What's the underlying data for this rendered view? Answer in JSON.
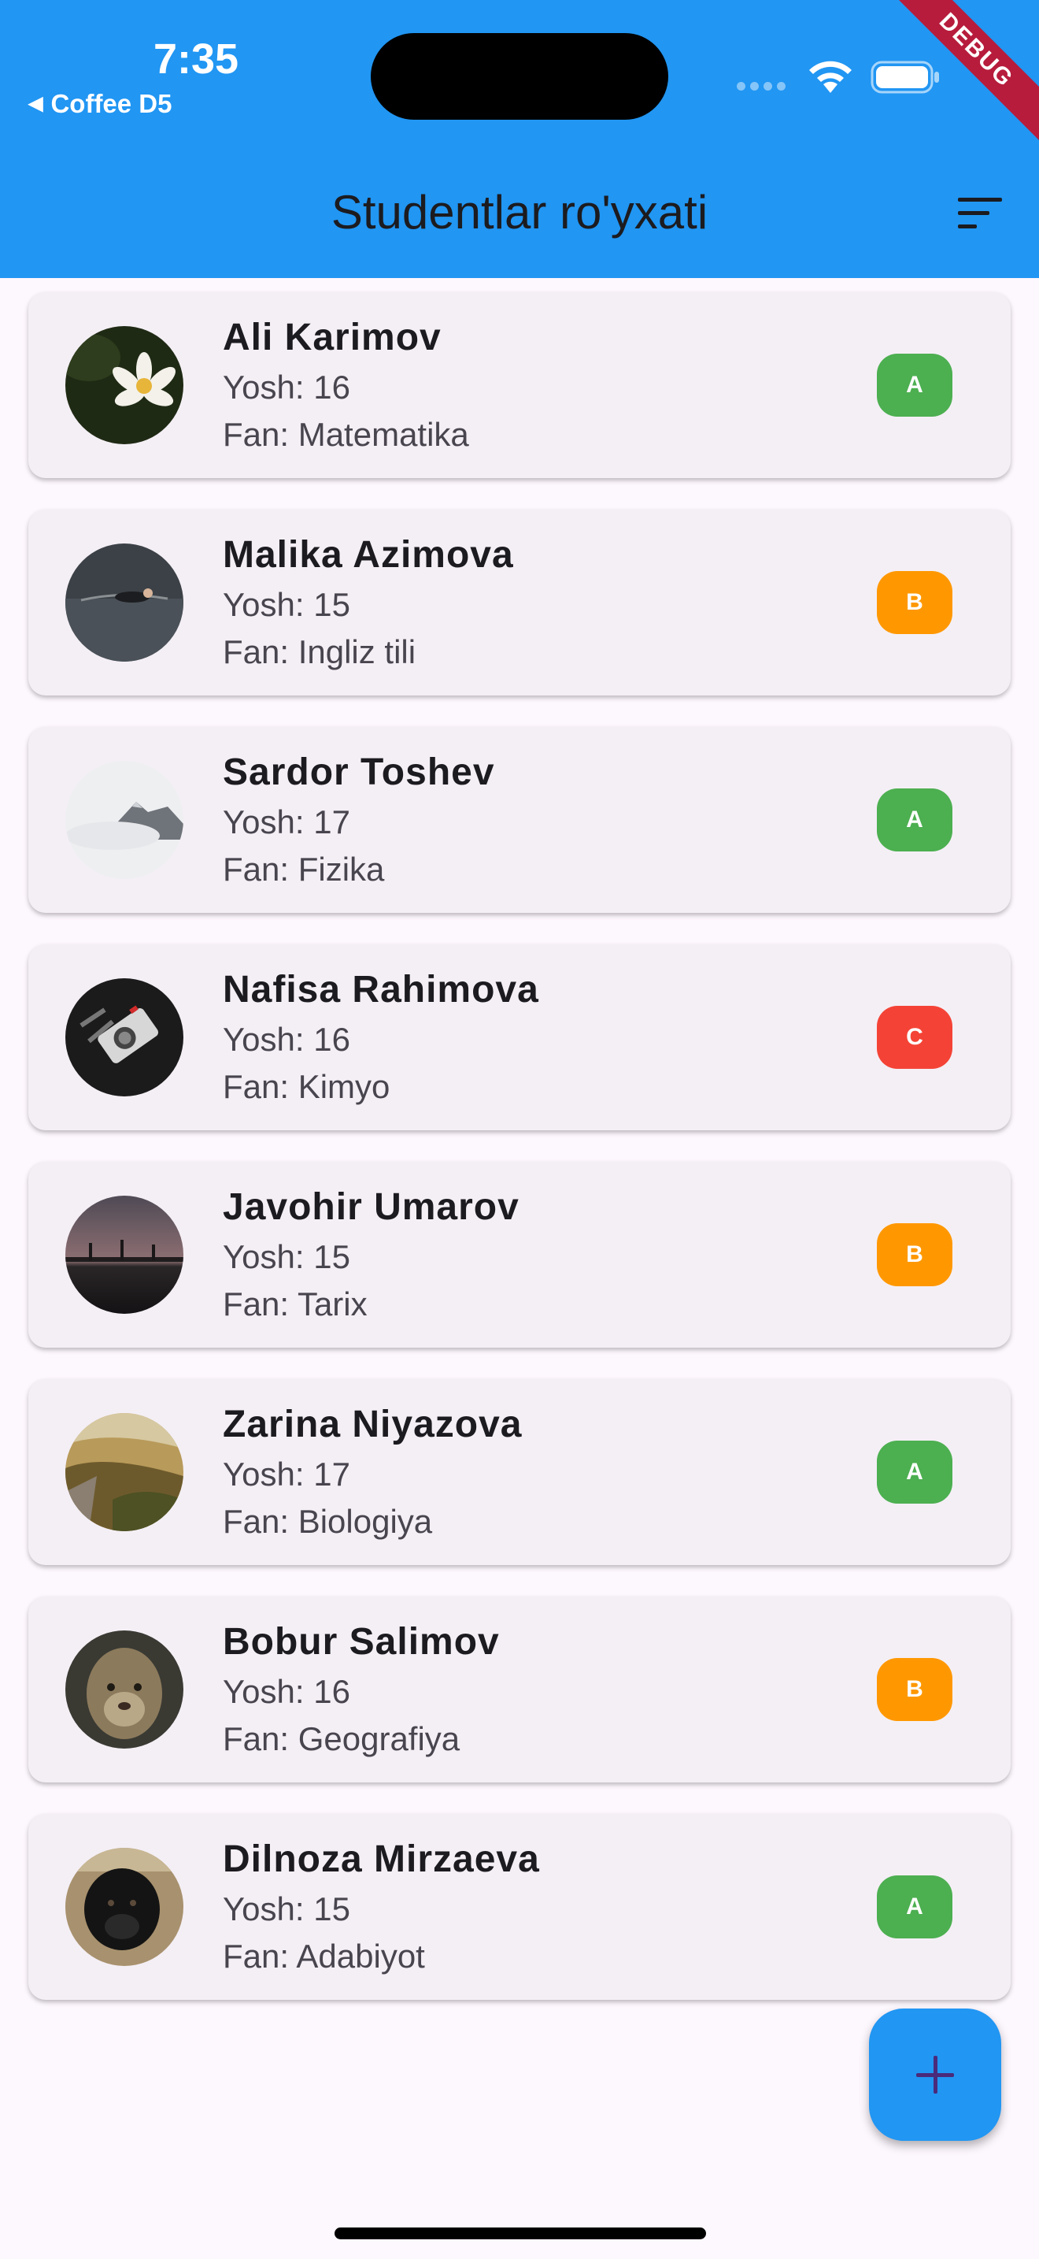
{
  "status_bar": {
    "time": "7:35",
    "back_app": "Coffee D5"
  },
  "debug_banner": "DEBUG",
  "app_bar": {
    "title": "Studentlar ro'yxati",
    "filter_icon": "filter-list-icon"
  },
  "students": [
    {
      "name": "Ali Karimov",
      "age": "Yosh: 16",
      "subject": "Fan: Matematika",
      "grade": "A",
      "grade_color": "#4caf50",
      "avatar": "water-lily-photo"
    },
    {
      "name": "Malika Azimova",
      "age": "Yosh: 15",
      "subject": "Fan: Ingliz tili",
      "grade": "B",
      "grade_color": "#ff9800",
      "avatar": "swimmer-photo"
    },
    {
      "name": "Sardor Toshev",
      "age": "Yosh: 17",
      "subject": "Fan: Fizika",
      "grade": "A",
      "grade_color": "#4caf50",
      "avatar": "misty-mountain-photo"
    },
    {
      "name": "Nafisa Rahimova",
      "age": "Yosh: 16",
      "subject": "Fan: Kimyo",
      "grade": "C",
      "grade_color": "#f44336",
      "avatar": "camera-photo"
    },
    {
      "name": "Javohir Umarov",
      "age": "Yosh: 15",
      "subject": "Fan: Tarix",
      "grade": "B",
      "grade_color": "#ff9800",
      "avatar": "bridge-dusk-photo"
    },
    {
      "name": "Zarina Niyazova",
      "age": "Yosh: 17",
      "subject": "Fan: Biologiya",
      "grade": "A",
      "grade_color": "#4caf50",
      "avatar": "mountain-valley-photo"
    },
    {
      "name": "Bobur Salimov",
      "age": "Yosh: 16",
      "subject": "Fan: Geografiya",
      "grade": "B",
      "grade_color": "#ff9800",
      "avatar": "lioness-photo"
    },
    {
      "name": "Dilnoza Mirzaeva",
      "age": "Yosh: 15",
      "subject": "Fan: Adabiyot",
      "grade": "A",
      "grade_color": "#4caf50",
      "avatar": "black-dog-photo"
    }
  ],
  "fab": {
    "icon": "add-icon"
  },
  "colors": {
    "primary": "#2196f3",
    "background": "#fdf7fe",
    "card": "#f4eff5"
  }
}
